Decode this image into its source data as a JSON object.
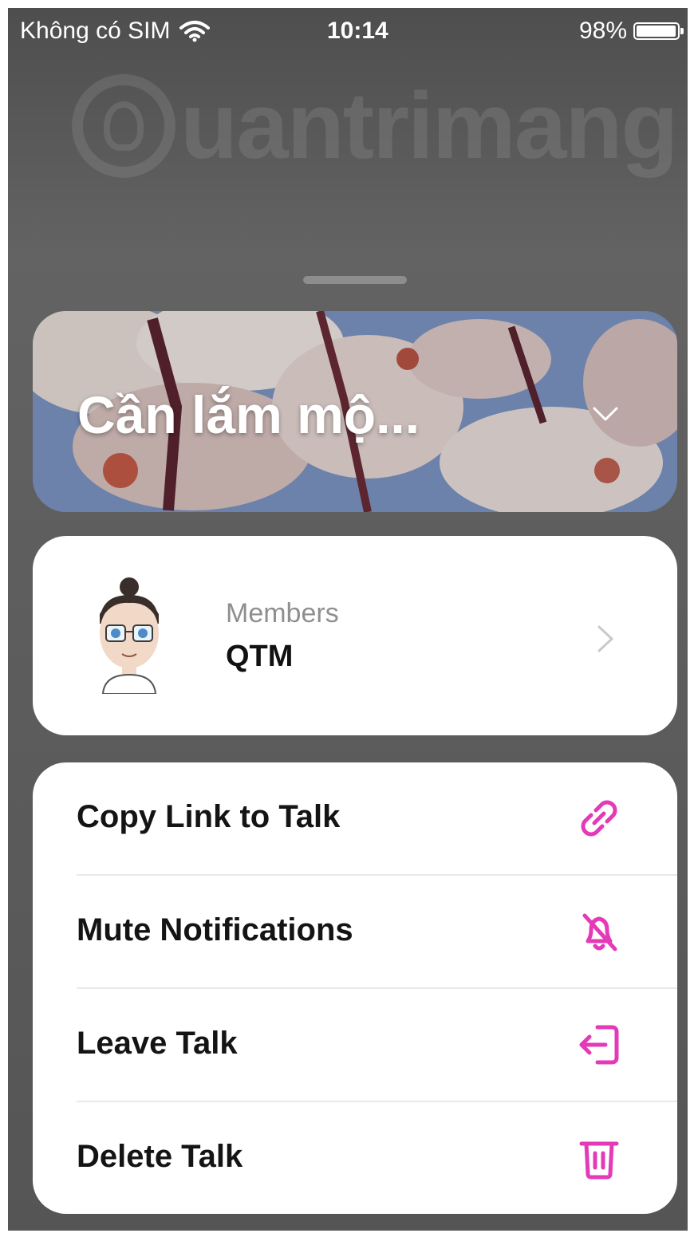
{
  "status_bar": {
    "carrier": "Không có SIM",
    "time": "10:14",
    "battery_percent": "98%",
    "battery_level": 0.98,
    "wifi_icon": "wifi-icon"
  },
  "watermark": {
    "text": "uantrimang",
    "logo_icon": "lightbulb-logo-icon"
  },
  "banner": {
    "title": "Cần lắm mộ...",
    "chevron_icon": "chevron-down-icon"
  },
  "members": {
    "label": "Members",
    "name": "QTM",
    "avatar_icon": "cartoon-avatar-icon",
    "chevron_icon": "chevron-right-icon"
  },
  "actions": [
    {
      "label": "Copy Link to Talk",
      "icon": "link-icon"
    },
    {
      "label": "Mute Notifications",
      "icon": "bell-slash-icon"
    },
    {
      "label": "Leave Talk",
      "icon": "leave-icon"
    },
    {
      "label": "Delete Talk",
      "icon": "trash-icon"
    }
  ],
  "colors": {
    "accent": "#e43ab8",
    "sheet_background": "#5a5a5a",
    "card_background": "#ffffff"
  }
}
